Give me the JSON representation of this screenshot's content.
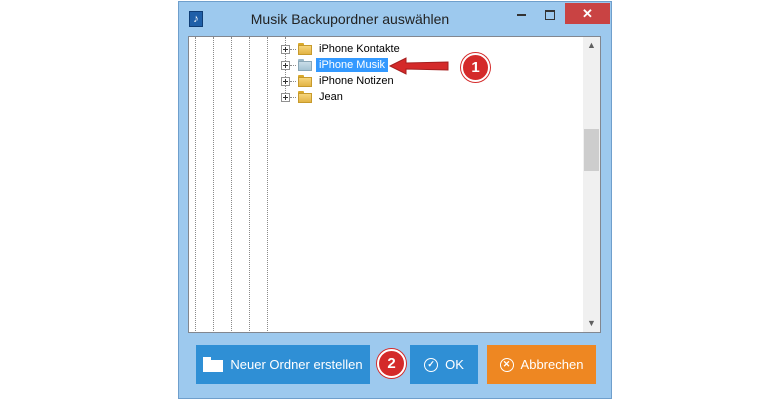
{
  "window": {
    "title": "Musik Backupordner auswählen",
    "app_icon_glyph": "♪",
    "minimize_icon": "minimize-icon",
    "maximize_icon": "maximize-icon",
    "close_label": "✕"
  },
  "tree": {
    "items": [
      {
        "label": "iPhone Kontakte",
        "selected": false
      },
      {
        "label": "iPhone Musik",
        "selected": true
      },
      {
        "label": "iPhone Notizen",
        "selected": false
      },
      {
        "label": "Jean",
        "selected": false
      }
    ],
    "scroll_up_glyph": "▲",
    "scroll_down_glyph": "▼"
  },
  "buttons": {
    "new_folder": "Neuer Ordner erstellen",
    "ok": "OK",
    "ok_icon_glyph": "✓",
    "cancel": "Abbrechen",
    "cancel_icon_glyph": "✕"
  },
  "annotations": {
    "badge_1": "1",
    "badge_2": "2"
  },
  "colors": {
    "accent_blue": "#2f8fd5",
    "cancel_orange": "#ee8722",
    "selection_blue": "#3399ff",
    "badge_red": "#d42a2a",
    "window_frame": "#9dc9ee"
  }
}
